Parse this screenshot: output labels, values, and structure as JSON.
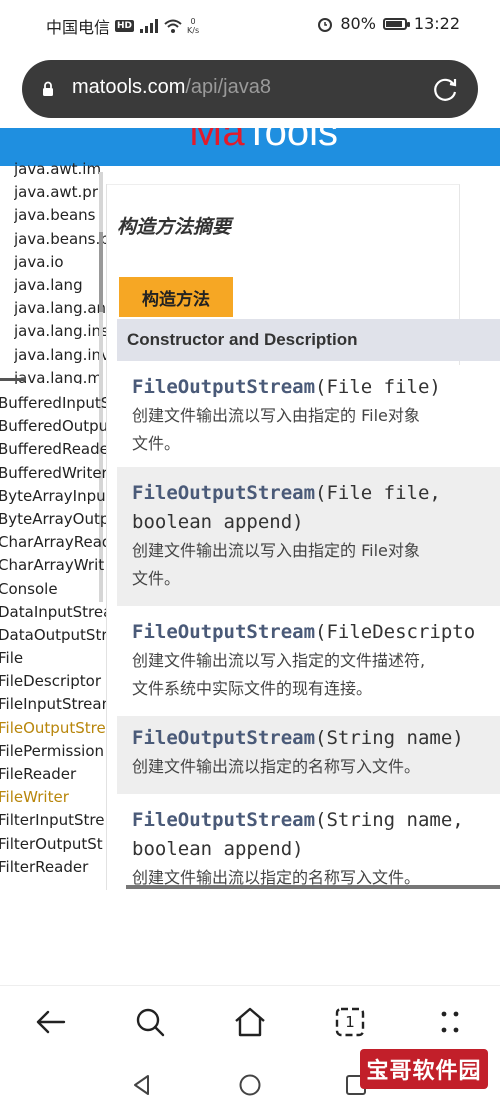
{
  "status_bar": {
    "carrier": "中国电信",
    "hd": "HD",
    "net_speed_value": "0",
    "net_speed_unit": "K/s",
    "battery": "80%",
    "time": "13:22"
  },
  "address_bar": {
    "host": "matools.com",
    "path": "/api/java8"
  },
  "site": {
    "brand_ma": "Ma",
    "brand_tools": "Tools"
  },
  "package_list": [
    "java.awt.im",
    "java.awt.pri",
    "java.beans",
    "java.beans.b",
    "java.io",
    "java.lang",
    "java.lang.an",
    "java.lang.ins",
    "java.lang.inv",
    "java.lang.m"
  ],
  "class_list": [
    "BufferedInputS",
    "BufferedOutpu",
    "BufferedReade",
    "BufferedWriter",
    "ByteArrayInput",
    "ByteArrayOutp",
    "CharArrayRead",
    "CharArrayWrit",
    "Console",
    "DataInputStrea",
    "DataOutputStr",
    "File",
    "FileDescriptor",
    "FileInputStrean",
    "FileOutputStre",
    "FilePermission",
    "FileReader",
    "FileWriter",
    "FilterInputStre",
    "FilterOutputSt",
    "FilterReader"
  ],
  "main": {
    "section_title": "构造方法摘要",
    "tab_label": "构造方法",
    "table_header": "Constructor and Description",
    "rows": [
      {
        "name": "FileOutputStream",
        "params": "(File file)",
        "params2": "",
        "desc1": "创建文件输出流以写入由指定的 File对象",
        "desc2": "文件。"
      },
      {
        "name": "FileOutputStream",
        "params": "(File file,",
        "params2": "boolean append)",
        "desc1": "创建文件输出流以写入由指定的 File对象",
        "desc2": "文件。"
      },
      {
        "name": "FileOutputStream",
        "params": "(FileDescripto",
        "params2": "",
        "desc1": "创建文件输出流以写入指定的文件描述符,",
        "desc2": "文件系统中实际文件的现有连接。"
      },
      {
        "name": "FileOutputStream",
        "params": "(String name)",
        "params2": "",
        "desc1": "创建文件输出流以指定的名称写入文件。",
        "desc2": ""
      },
      {
        "name": "FileOutputStream",
        "params": "(String name,",
        "params2": "boolean append)",
        "desc1": "创建文件输出流以指定的名称写入文件。",
        "desc2": ""
      }
    ]
  },
  "watermark": {
    "text": "宝哥软件园"
  },
  "icons": {
    "back": "back-arrow-icon",
    "search": "search-icon",
    "home": "home-icon",
    "tabs": "tabs-icon",
    "tab_count": "1",
    "menu": "menu-dots-icon"
  }
}
